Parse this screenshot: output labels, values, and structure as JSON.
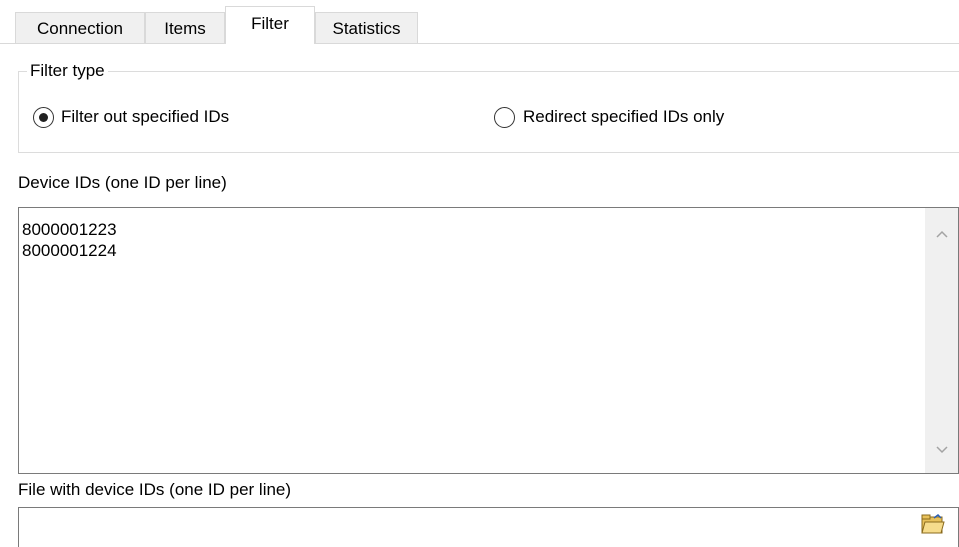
{
  "tabs": [
    {
      "label": "Connection",
      "active": false
    },
    {
      "label": "Items",
      "active": false
    },
    {
      "label": "Filter",
      "active": true
    },
    {
      "label": "Statistics",
      "active": false
    }
  ],
  "filter_type": {
    "title": "Filter type",
    "options": [
      {
        "label": "Filter out specified IDs",
        "selected": true
      },
      {
        "label": "Redirect specified IDs only",
        "selected": false
      }
    ]
  },
  "device_ids": {
    "label": "Device IDs (one ID per line)",
    "lines": [
      "8000001223",
      "8000001224"
    ]
  },
  "file_ids": {
    "label": "File with device IDs (one ID per line)",
    "value": "",
    "browse_icon": "folder-open-icon"
  },
  "colors": {
    "tab_inactive_bg": "#f0f0f0",
    "border": "#d9d9d9",
    "scrollbar_bg": "#f0f0f0",
    "folder_icon": "#e8c15a"
  }
}
